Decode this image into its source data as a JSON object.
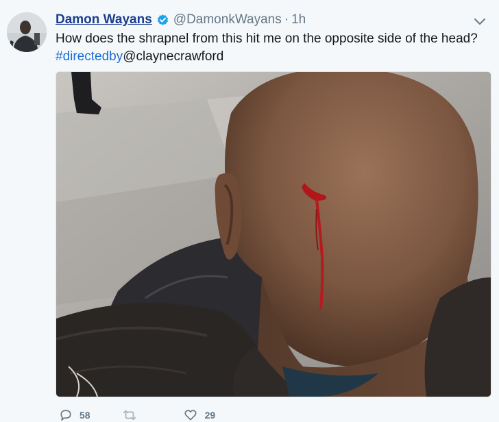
{
  "tweet": {
    "author_name": "Damon Wayans",
    "handle": "@DamonkWayans",
    "separator": "·",
    "time": "1h",
    "text": "How does the shrapnel from this hit me on the opposite side of the head?",
    "hashtag": "#directedby",
    "mention": "@claynecrawford"
  },
  "actions": {
    "reply_count": "58",
    "like_count": "29"
  },
  "icons": {
    "verified": "verified-badge-icon",
    "caret": "chevron-down-icon",
    "reply": "reply-icon",
    "retweet": "retweet-icon",
    "like": "heart-icon"
  },
  "colors": {
    "name": "#1b3d8f",
    "link": "#1b6ed4",
    "muted": "#657786",
    "verified": "#1da1f2"
  }
}
